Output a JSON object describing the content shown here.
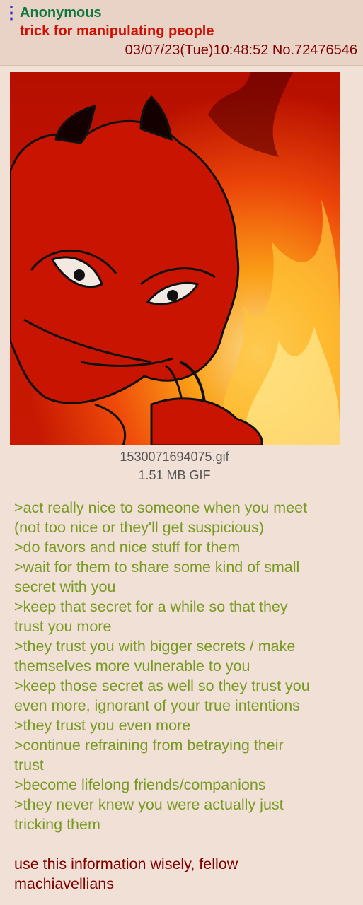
{
  "post": {
    "name": "Anonymous",
    "subject": "trick for manipulating people",
    "datetime": "03/07/23(Tue)10:48:52",
    "post_number": "No.72476546",
    "menu_icon": "vertical-ellipsis-icon"
  },
  "file": {
    "filename": "1530071694075.gif",
    "info": "1.51 MB GIF"
  },
  "body": {
    "greentext_lines": [
      ">act really nice to someone when you meet",
      "(not too nice or they'll get suspicious)",
      ">do favors and nice stuff for them",
      ">wait for them to share some kind of small",
      "secret with you",
      ">keep that secret for a while so that they",
      "trust you more",
      ">they trust you with bigger secrets / make",
      "themselves more vulnerable to you",
      ">keep those secret as well so they trust you",
      "even more, ignorant of your true intentions",
      ">they trust you even more",
      ">continue refraining from betraying their",
      "trust",
      ">become lifelong friends/companions",
      ">they never knew you were actually just",
      "tricking them"
    ],
    "closing_lines": [
      "use this information wisely, fellow",
      "machiavellians"
    ]
  },
  "colors": {
    "background": "#f0e0d6",
    "header": "#e8d3c6",
    "name": "#117743",
    "subject": "#cc1105",
    "meta": "#800000",
    "greentext": "#789922",
    "text": "#800000"
  }
}
